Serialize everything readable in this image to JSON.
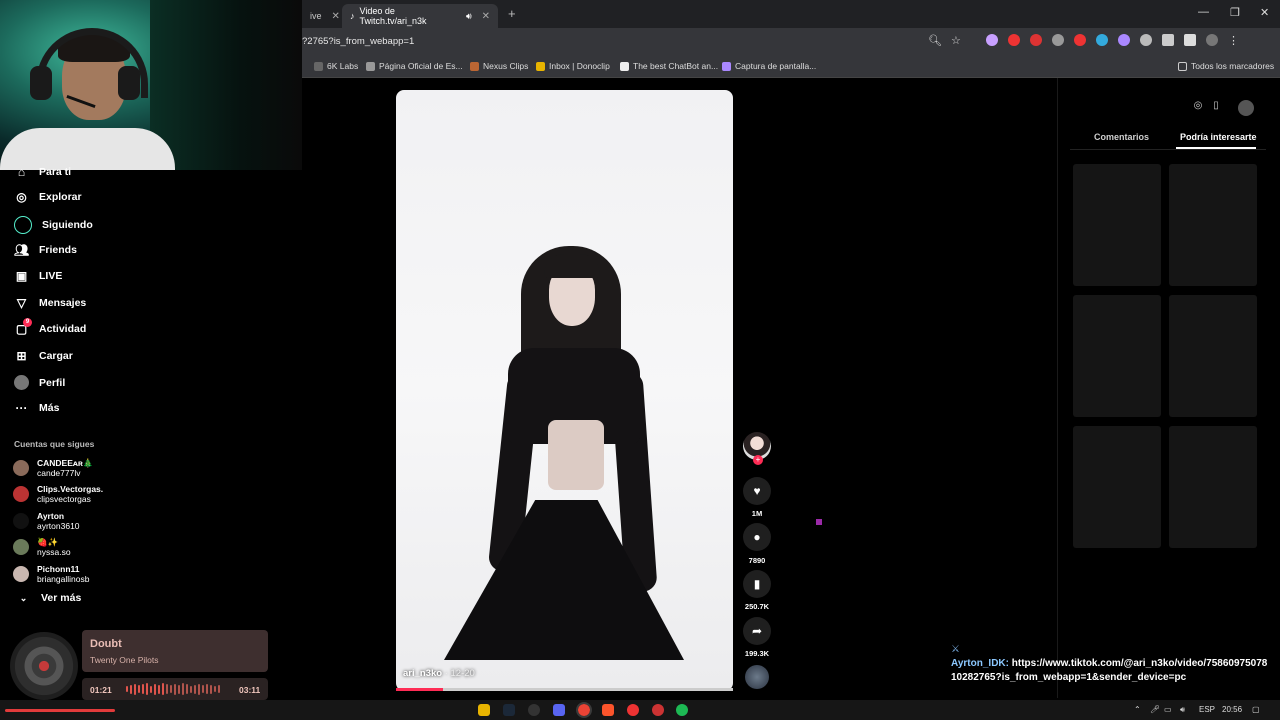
{
  "browser": {
    "tabs": [
      {
        "label": "ive"
      },
      {
        "label": "Video de Twitch.tv/ari_n3k"
      }
    ],
    "url": "?2765?is_from_webapp=1",
    "bookmarks": [
      {
        "label": "6K Labs"
      },
      {
        "label": "Página Oficial de Es..."
      },
      {
        "label": "Nexus Clips"
      },
      {
        "label": "Inbox | Donoclip"
      },
      {
        "label": "The best ChatBot an..."
      },
      {
        "label": "Captura de pantalla..."
      },
      {
        "label": "Todos los marcadores"
      }
    ]
  },
  "sidebar": {
    "items": [
      {
        "label": "Para ti",
        "icon": "home-icon"
      },
      {
        "label": "Explorar",
        "icon": "compass-icon"
      },
      {
        "label": "Siguiendo",
        "icon": "circle-icon"
      },
      {
        "label": "Friends",
        "icon": "people-icon"
      },
      {
        "label": "LIVE",
        "icon": "tv-icon"
      },
      {
        "label": "Mensajes",
        "icon": "send-icon"
      },
      {
        "label": "Actividad",
        "icon": "bell-icon",
        "badge": "9"
      },
      {
        "label": "Cargar",
        "icon": "plus-icon"
      },
      {
        "label": "Perfil",
        "icon": "avatar-icon"
      },
      {
        "label": "Más",
        "icon": "dots-icon"
      }
    ],
    "following_title": "Cuentas que sigues",
    "following": [
      {
        "name": "CANDEEᴀʀ🎄",
        "handle": "cande777lv"
      },
      {
        "name": "Clips.Vectorgas.",
        "handle": "clipsvectorgas"
      },
      {
        "name": "Ayrton",
        "handle": "ayrton3610"
      },
      {
        "name": "🍓✨",
        "handle": "nyssa.so"
      },
      {
        "name": "Pichonn11",
        "handle": "briangallinosb"
      }
    ],
    "see_more": "Ver más"
  },
  "spotify": {
    "title": "Doubt",
    "artist": "Twenty One Pilots",
    "elapsed": "01:21",
    "duration": "03:11",
    "progress": 0.42
  },
  "video": {
    "username": "ari_n3ko",
    "date": "· 12-20",
    "progress": 0.14
  },
  "actions": {
    "likes": "1M",
    "comments": "7890",
    "saves": "250.7K",
    "shares": "199.3K"
  },
  "right_panel": {
    "tabs": [
      "Comentarios",
      "Podría interesarte"
    ],
    "active_tab": 1
  },
  "chat": {
    "user": "Ayrton_IDK:",
    "message": "https://www.tiktok.com/@ari_n3ko/video/7586097507810282765?is_from_webapp=1&sender_device=pc"
  },
  "taskbar": {
    "lang": "ESP",
    "time": "20:56"
  },
  "colors": {
    "accent": "#fe2c55",
    "chat_user": "#8cc8ff",
    "spotify_card": "#3e2f2f"
  }
}
